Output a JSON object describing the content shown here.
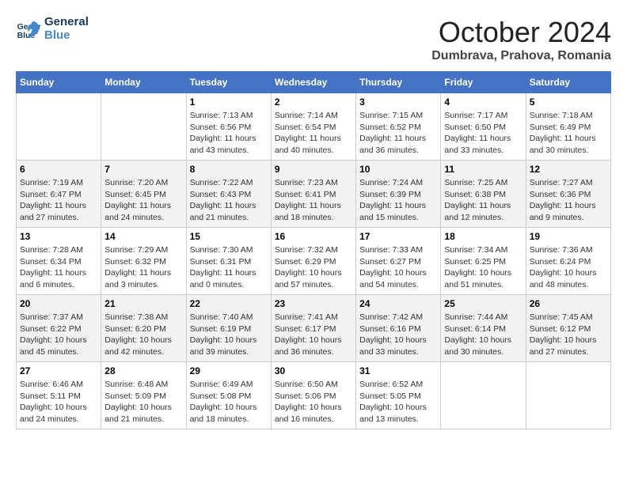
{
  "logo": {
    "line1": "General",
    "line2": "Blue"
  },
  "title": "October 2024",
  "location": "Dumbrava, Prahova, Romania",
  "weekdays": [
    "Sunday",
    "Monday",
    "Tuesday",
    "Wednesday",
    "Thursday",
    "Friday",
    "Saturday"
  ],
  "weeks": [
    [
      {
        "day": "",
        "sunrise": "",
        "sunset": "",
        "daylight": ""
      },
      {
        "day": "",
        "sunrise": "",
        "sunset": "",
        "daylight": ""
      },
      {
        "day": "1",
        "sunrise": "Sunrise: 7:13 AM",
        "sunset": "Sunset: 6:56 PM",
        "daylight": "Daylight: 11 hours and 43 minutes."
      },
      {
        "day": "2",
        "sunrise": "Sunrise: 7:14 AM",
        "sunset": "Sunset: 6:54 PM",
        "daylight": "Daylight: 11 hours and 40 minutes."
      },
      {
        "day": "3",
        "sunrise": "Sunrise: 7:15 AM",
        "sunset": "Sunset: 6:52 PM",
        "daylight": "Daylight: 11 hours and 36 minutes."
      },
      {
        "day": "4",
        "sunrise": "Sunrise: 7:17 AM",
        "sunset": "Sunset: 6:50 PM",
        "daylight": "Daylight: 11 hours and 33 minutes."
      },
      {
        "day": "5",
        "sunrise": "Sunrise: 7:18 AM",
        "sunset": "Sunset: 6:49 PM",
        "daylight": "Daylight: 11 hours and 30 minutes."
      }
    ],
    [
      {
        "day": "6",
        "sunrise": "Sunrise: 7:19 AM",
        "sunset": "Sunset: 6:47 PM",
        "daylight": "Daylight: 11 hours and 27 minutes."
      },
      {
        "day": "7",
        "sunrise": "Sunrise: 7:20 AM",
        "sunset": "Sunset: 6:45 PM",
        "daylight": "Daylight: 11 hours and 24 minutes."
      },
      {
        "day": "8",
        "sunrise": "Sunrise: 7:22 AM",
        "sunset": "Sunset: 6:43 PM",
        "daylight": "Daylight: 11 hours and 21 minutes."
      },
      {
        "day": "9",
        "sunrise": "Sunrise: 7:23 AM",
        "sunset": "Sunset: 6:41 PM",
        "daylight": "Daylight: 11 hours and 18 minutes."
      },
      {
        "day": "10",
        "sunrise": "Sunrise: 7:24 AM",
        "sunset": "Sunset: 6:39 PM",
        "daylight": "Daylight: 11 hours and 15 minutes."
      },
      {
        "day": "11",
        "sunrise": "Sunrise: 7:25 AM",
        "sunset": "Sunset: 6:38 PM",
        "daylight": "Daylight: 11 hours and 12 minutes."
      },
      {
        "day": "12",
        "sunrise": "Sunrise: 7:27 AM",
        "sunset": "Sunset: 6:36 PM",
        "daylight": "Daylight: 11 hours and 9 minutes."
      }
    ],
    [
      {
        "day": "13",
        "sunrise": "Sunrise: 7:28 AM",
        "sunset": "Sunset: 6:34 PM",
        "daylight": "Daylight: 11 hours and 6 minutes."
      },
      {
        "day": "14",
        "sunrise": "Sunrise: 7:29 AM",
        "sunset": "Sunset: 6:32 PM",
        "daylight": "Daylight: 11 hours and 3 minutes."
      },
      {
        "day": "15",
        "sunrise": "Sunrise: 7:30 AM",
        "sunset": "Sunset: 6:31 PM",
        "daylight": "Daylight: 11 hours and 0 minutes."
      },
      {
        "day": "16",
        "sunrise": "Sunrise: 7:32 AM",
        "sunset": "Sunset: 6:29 PM",
        "daylight": "Daylight: 10 hours and 57 minutes."
      },
      {
        "day": "17",
        "sunrise": "Sunrise: 7:33 AM",
        "sunset": "Sunset: 6:27 PM",
        "daylight": "Daylight: 10 hours and 54 minutes."
      },
      {
        "day": "18",
        "sunrise": "Sunrise: 7:34 AM",
        "sunset": "Sunset: 6:25 PM",
        "daylight": "Daylight: 10 hours and 51 minutes."
      },
      {
        "day": "19",
        "sunrise": "Sunrise: 7:36 AM",
        "sunset": "Sunset: 6:24 PM",
        "daylight": "Daylight: 10 hours and 48 minutes."
      }
    ],
    [
      {
        "day": "20",
        "sunrise": "Sunrise: 7:37 AM",
        "sunset": "Sunset: 6:22 PM",
        "daylight": "Daylight: 10 hours and 45 minutes."
      },
      {
        "day": "21",
        "sunrise": "Sunrise: 7:38 AM",
        "sunset": "Sunset: 6:20 PM",
        "daylight": "Daylight: 10 hours and 42 minutes."
      },
      {
        "day": "22",
        "sunrise": "Sunrise: 7:40 AM",
        "sunset": "Sunset: 6:19 PM",
        "daylight": "Daylight: 10 hours and 39 minutes."
      },
      {
        "day": "23",
        "sunrise": "Sunrise: 7:41 AM",
        "sunset": "Sunset: 6:17 PM",
        "daylight": "Daylight: 10 hours and 36 minutes."
      },
      {
        "day": "24",
        "sunrise": "Sunrise: 7:42 AM",
        "sunset": "Sunset: 6:16 PM",
        "daylight": "Daylight: 10 hours and 33 minutes."
      },
      {
        "day": "25",
        "sunrise": "Sunrise: 7:44 AM",
        "sunset": "Sunset: 6:14 PM",
        "daylight": "Daylight: 10 hours and 30 minutes."
      },
      {
        "day": "26",
        "sunrise": "Sunrise: 7:45 AM",
        "sunset": "Sunset: 6:12 PM",
        "daylight": "Daylight: 10 hours and 27 minutes."
      }
    ],
    [
      {
        "day": "27",
        "sunrise": "Sunrise: 6:46 AM",
        "sunset": "Sunset: 5:11 PM",
        "daylight": "Daylight: 10 hours and 24 minutes."
      },
      {
        "day": "28",
        "sunrise": "Sunrise: 6:48 AM",
        "sunset": "Sunset: 5:09 PM",
        "daylight": "Daylight: 10 hours and 21 minutes."
      },
      {
        "day": "29",
        "sunrise": "Sunrise: 6:49 AM",
        "sunset": "Sunset: 5:08 PM",
        "daylight": "Daylight: 10 hours and 18 minutes."
      },
      {
        "day": "30",
        "sunrise": "Sunrise: 6:50 AM",
        "sunset": "Sunset: 5:06 PM",
        "daylight": "Daylight: 10 hours and 16 minutes."
      },
      {
        "day": "31",
        "sunrise": "Sunrise: 6:52 AM",
        "sunset": "Sunset: 5:05 PM",
        "daylight": "Daylight: 10 hours and 13 minutes."
      },
      {
        "day": "",
        "sunrise": "",
        "sunset": "",
        "daylight": ""
      },
      {
        "day": "",
        "sunrise": "",
        "sunset": "",
        "daylight": ""
      }
    ]
  ]
}
